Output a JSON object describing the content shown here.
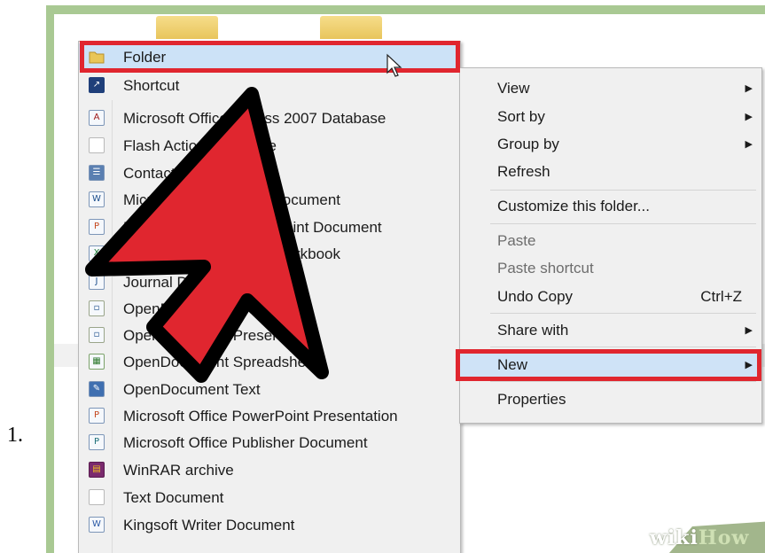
{
  "step": {
    "number": "1."
  },
  "new_submenu": {
    "items": [
      {
        "label": "Folder",
        "icon": "folder-icon",
        "glyph": ""
      },
      {
        "label": "Shortcut",
        "icon": "shortcut-icon",
        "glyph": "↗"
      },
      {
        "label": "Microsoft Office Access 2007 Database",
        "icon": "access-icon",
        "glyph": "A"
      },
      {
        "label": "Flash Action Script File",
        "icon": "flash-file-icon",
        "glyph": ""
      },
      {
        "label": "Contact",
        "icon": "contact-icon",
        "glyph": "☰"
      },
      {
        "label": "Microsoft Office Word Document",
        "icon": "word-icon",
        "glyph": "W"
      },
      {
        "label": "Microsoft Office PowerPoint Document",
        "icon": "powerpoint-icon",
        "glyph": "P"
      },
      {
        "label": "Microsoft Office Excel Workbook",
        "icon": "excel-icon",
        "glyph": "X"
      },
      {
        "label": "Journal Document",
        "icon": "journal-icon",
        "glyph": "J"
      },
      {
        "label": "OpenDocument Drawing",
        "icon": "odg-icon",
        "glyph": "▫"
      },
      {
        "label": "OpenDocument Presentation",
        "icon": "odp-icon",
        "glyph": "▫"
      },
      {
        "label": "OpenDocument Spreadsheet",
        "icon": "ods-icon",
        "glyph": "▦"
      },
      {
        "label": "OpenDocument Text",
        "icon": "odt-icon",
        "glyph": "✎"
      },
      {
        "label": "Microsoft Office PowerPoint Presentation",
        "icon": "pptx-icon",
        "glyph": "P"
      },
      {
        "label": "Microsoft Office Publisher Document",
        "icon": "publisher-icon",
        "glyph": "P"
      },
      {
        "label": "WinRAR archive",
        "icon": "winrar-icon",
        "glyph": "▤"
      },
      {
        "label": "Text Document",
        "icon": "text-file-icon",
        "glyph": ""
      },
      {
        "label": "Kingsoft Writer Document",
        "icon": "kingsoft-writer-icon",
        "glyph": "W"
      }
    ]
  },
  "context_menu": {
    "items": [
      {
        "label": "View",
        "submenu": true,
        "shortcut": "",
        "disabled": false
      },
      {
        "label": "Sort by",
        "submenu": true,
        "shortcut": "",
        "disabled": false
      },
      {
        "label": "Group by",
        "submenu": true,
        "shortcut": "",
        "disabled": false
      },
      {
        "label": "Refresh",
        "submenu": false,
        "shortcut": "",
        "disabled": false
      },
      {
        "label": "Customize this folder...",
        "submenu": false,
        "shortcut": "",
        "disabled": false
      },
      {
        "label": "Paste",
        "submenu": false,
        "shortcut": "",
        "disabled": true
      },
      {
        "label": "Paste shortcut",
        "submenu": false,
        "shortcut": "",
        "disabled": true
      },
      {
        "label": "Undo Copy",
        "submenu": false,
        "shortcut": "Ctrl+Z",
        "disabled": false
      },
      {
        "label": "Share with",
        "submenu": true,
        "shortcut": "",
        "disabled": false
      },
      {
        "label": "New",
        "submenu": true,
        "shortcut": "",
        "disabled": false
      },
      {
        "label": "Properties",
        "submenu": false,
        "shortcut": "",
        "disabled": false
      }
    ],
    "submenu_glyph": "▶"
  },
  "watermark": {
    "wiki": "wiki",
    "how": "How"
  },
  "colors": {
    "highlight_outline": "#e0262f",
    "arrow_fill": "#e0262f",
    "frame": "#a9c993"
  }
}
